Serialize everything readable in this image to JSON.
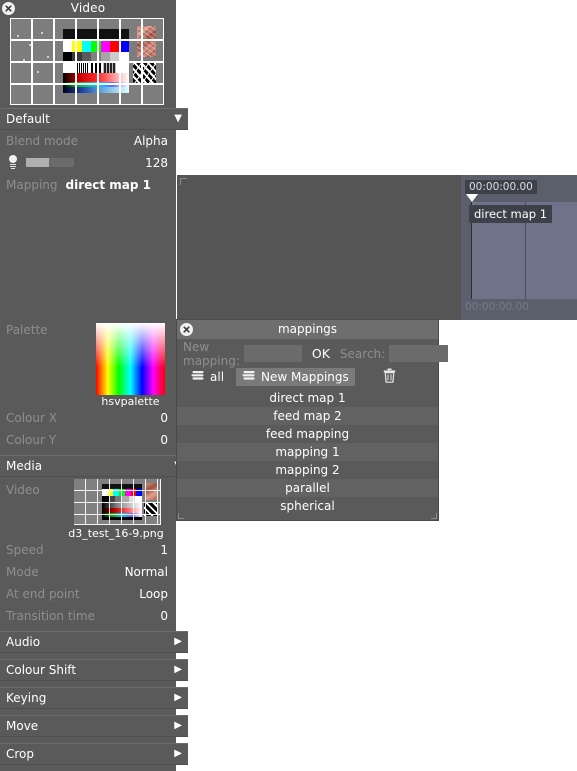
{
  "properties_panel": {
    "title": "Video",
    "close_icon": "close-circle-icon",
    "preview": {
      "name": "video-preview-thumbnail"
    },
    "layer_section": {
      "name": "Default",
      "arrow": "▼"
    },
    "blend_mode": {
      "label": "Blend mode",
      "value": "Alpha"
    },
    "brightness": {
      "icon": "lightbulb-icon",
      "value": "128"
    },
    "mapping": {
      "label": "Mapping",
      "value": "direct map 1"
    },
    "palette": {
      "label": "Palette",
      "name": "hsvpalette"
    },
    "colour_x": {
      "label": "Colour X",
      "value": "0"
    },
    "colour_y": {
      "label": "Colour Y",
      "value": "0"
    },
    "media_section": {
      "name": "Media",
      "arrow": "▼"
    },
    "video": {
      "label": "Video",
      "filename": "d3_test_16-9.png"
    },
    "speed": {
      "label": "Speed",
      "value": "1"
    },
    "mode": {
      "label": "Mode",
      "value": "Normal"
    },
    "at_end_point": {
      "label": "At end point",
      "value": "Loop"
    },
    "transition_time": {
      "label": "Transition time",
      "value": "0"
    },
    "collapsed_sections": [
      {
        "label": "Audio",
        "arrow": "▶"
      },
      {
        "label": "Colour Shift",
        "arrow": "▶"
      },
      {
        "label": "Keying",
        "arrow": "▶"
      },
      {
        "label": "Move",
        "arrow": "▶"
      },
      {
        "label": "Crop",
        "arrow": "▶"
      }
    ]
  },
  "timeline": {
    "timecode_top": "00:00:00.00",
    "timecode_bottom": "00:00:00.00",
    "clip_label": "direct map 1",
    "playhead_icon": "playhead-marker-icon"
  },
  "mappings_dialog": {
    "title": "mappings",
    "close_icon": "close-circle-icon",
    "new_mapping_label": "New mapping:",
    "new_mapping_value": "",
    "new_mapping_placeholder": "",
    "ok_label": "OK",
    "search_label": "Search:",
    "search_value": "",
    "search_placeholder": "",
    "tab_all": {
      "label": "all",
      "icon": "stack-icon"
    },
    "tab_new_mappings": {
      "label": "New Mappings",
      "icon": "stack-icon"
    },
    "delete_icon": "trash-icon",
    "items": [
      "direct map 1",
      "feed map 2",
      "feed mapping",
      "mapping 1",
      "mapping 2",
      "parallel",
      "spherical"
    ]
  },
  "colors": {
    "panel_bg": "#5a5a5a",
    "panel_bg_alt": "#555555",
    "timeline_bg": "#5b5f6b",
    "clip_fill": "#6f7389",
    "label_dim": "#8e8e8e",
    "text": "#ffffff",
    "dialog_titlebar": "#6e6e6e",
    "tab_active": "#7a7a7a"
  }
}
